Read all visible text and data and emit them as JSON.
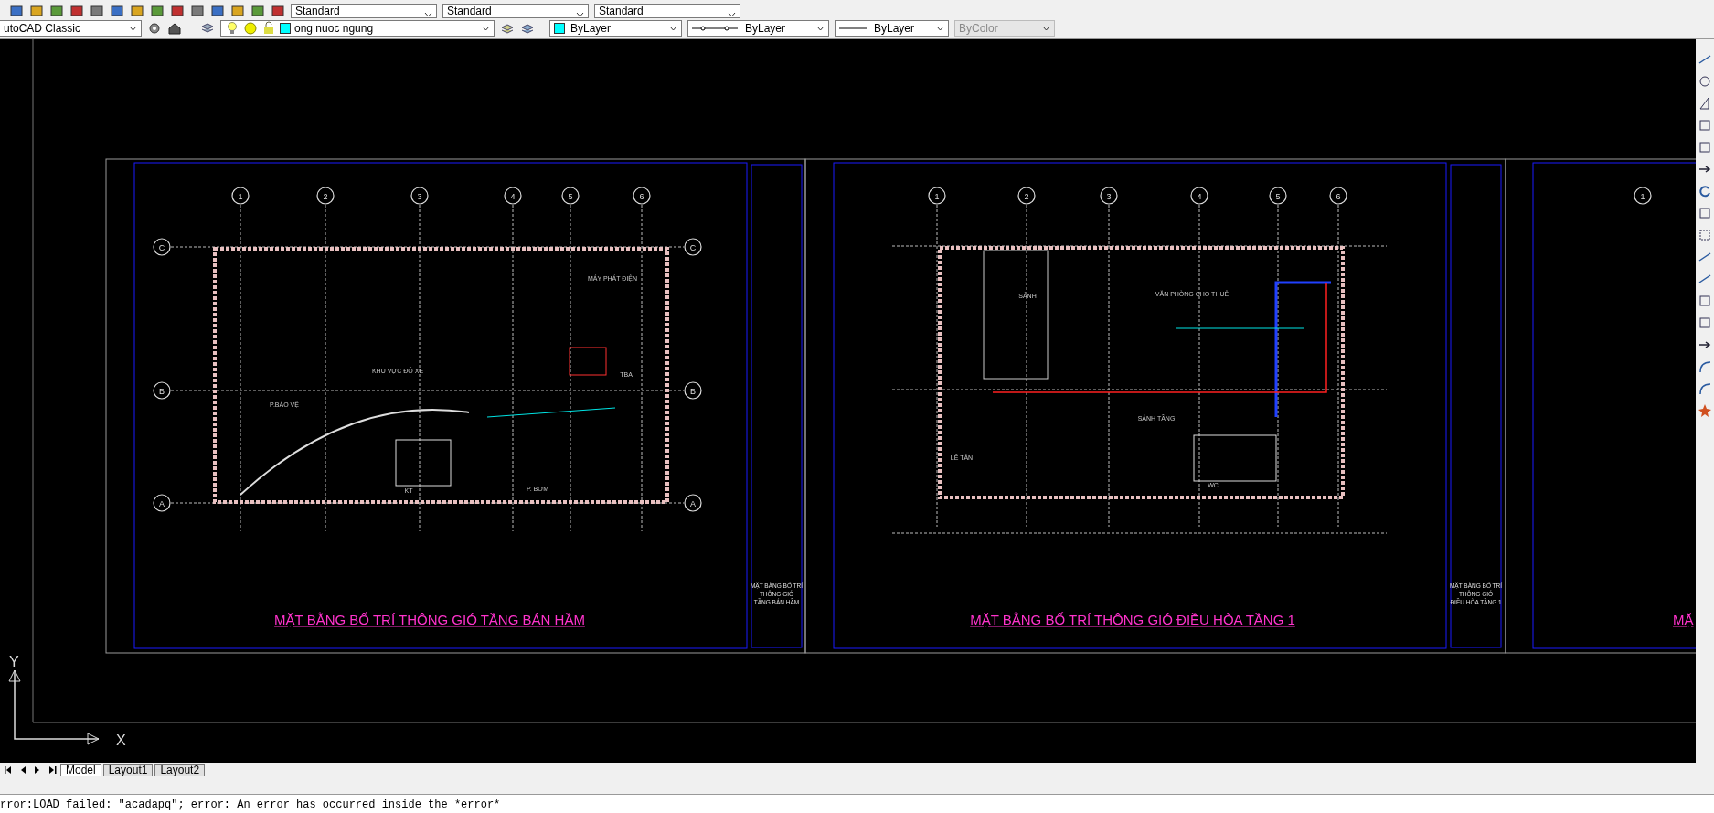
{
  "toolbar": {
    "styles": [
      "Standard",
      "Standard",
      "Standard"
    ],
    "workspace": "utoCAD Classic",
    "layer": "ong nuoc ngung",
    "color_setting": "ByLayer",
    "linetype": "ByLayer",
    "lineweight": "ByLayer",
    "plot_style": {
      "value": "ByColor",
      "disabled": true
    }
  },
  "drawing": {
    "sheets": [
      {
        "kind": "basement",
        "title": "MẶT BẰNG BỐ TRÍ THÔNG GIÓ TẦNG BÁN HẦM",
        "title_block": [
          "MẶT BẰNG BỐ TRÍ",
          "THÔNG GIÓ",
          "TẦNG BÁN HẦM"
        ],
        "grid_columns": [
          "1",
          "2",
          "3",
          "4",
          "5",
          "6"
        ],
        "grid_rows": [
          {
            "left": "C",
            "right": "C"
          },
          {
            "left": "B",
            "right": "B"
          },
          {
            "left": "A",
            "right": "A"
          }
        ],
        "rooms": [
          "KHU VỰC ĐỖ XE",
          "MÁY PHÁT ĐIỆN",
          "TBA",
          "P.BẢO VỆ",
          "P. BƠM",
          "KT"
        ]
      },
      {
        "kind": "ground",
        "title": "MẶT BẰNG BỐ TRÍ THÔNG GIÓ ĐIỀU HÒA TẦNG 1",
        "title_block": [
          "MẶT BẰNG BỐ TRÍ",
          "THÔNG GIÓ",
          "ĐIỀU HÒA TẦNG 1"
        ],
        "grid_columns": [
          "1",
          "2",
          "3",
          "4",
          "5",
          "6"
        ],
        "rooms": [
          "SẢNH",
          "VĂN PHÒNG CHO THUÊ",
          "SẢNH TẦNG",
          "LỄ TÂN",
          "WC"
        ]
      },
      {
        "kind": "partial",
        "title": "MẶ",
        "grid_columns": [
          "1"
        ]
      }
    ],
    "ucs": {
      "x": "X",
      "y": "Y"
    }
  },
  "tabs": [
    {
      "label": "Model",
      "selected": true
    },
    {
      "label": "Layout1",
      "selected": false
    },
    {
      "label": "Layout2",
      "selected": false
    }
  ],
  "command_line": {
    "lines": [
      "rror:LOAD failed: \"acadapq\"; error: An error has occurred inside the *error*"
    ]
  }
}
